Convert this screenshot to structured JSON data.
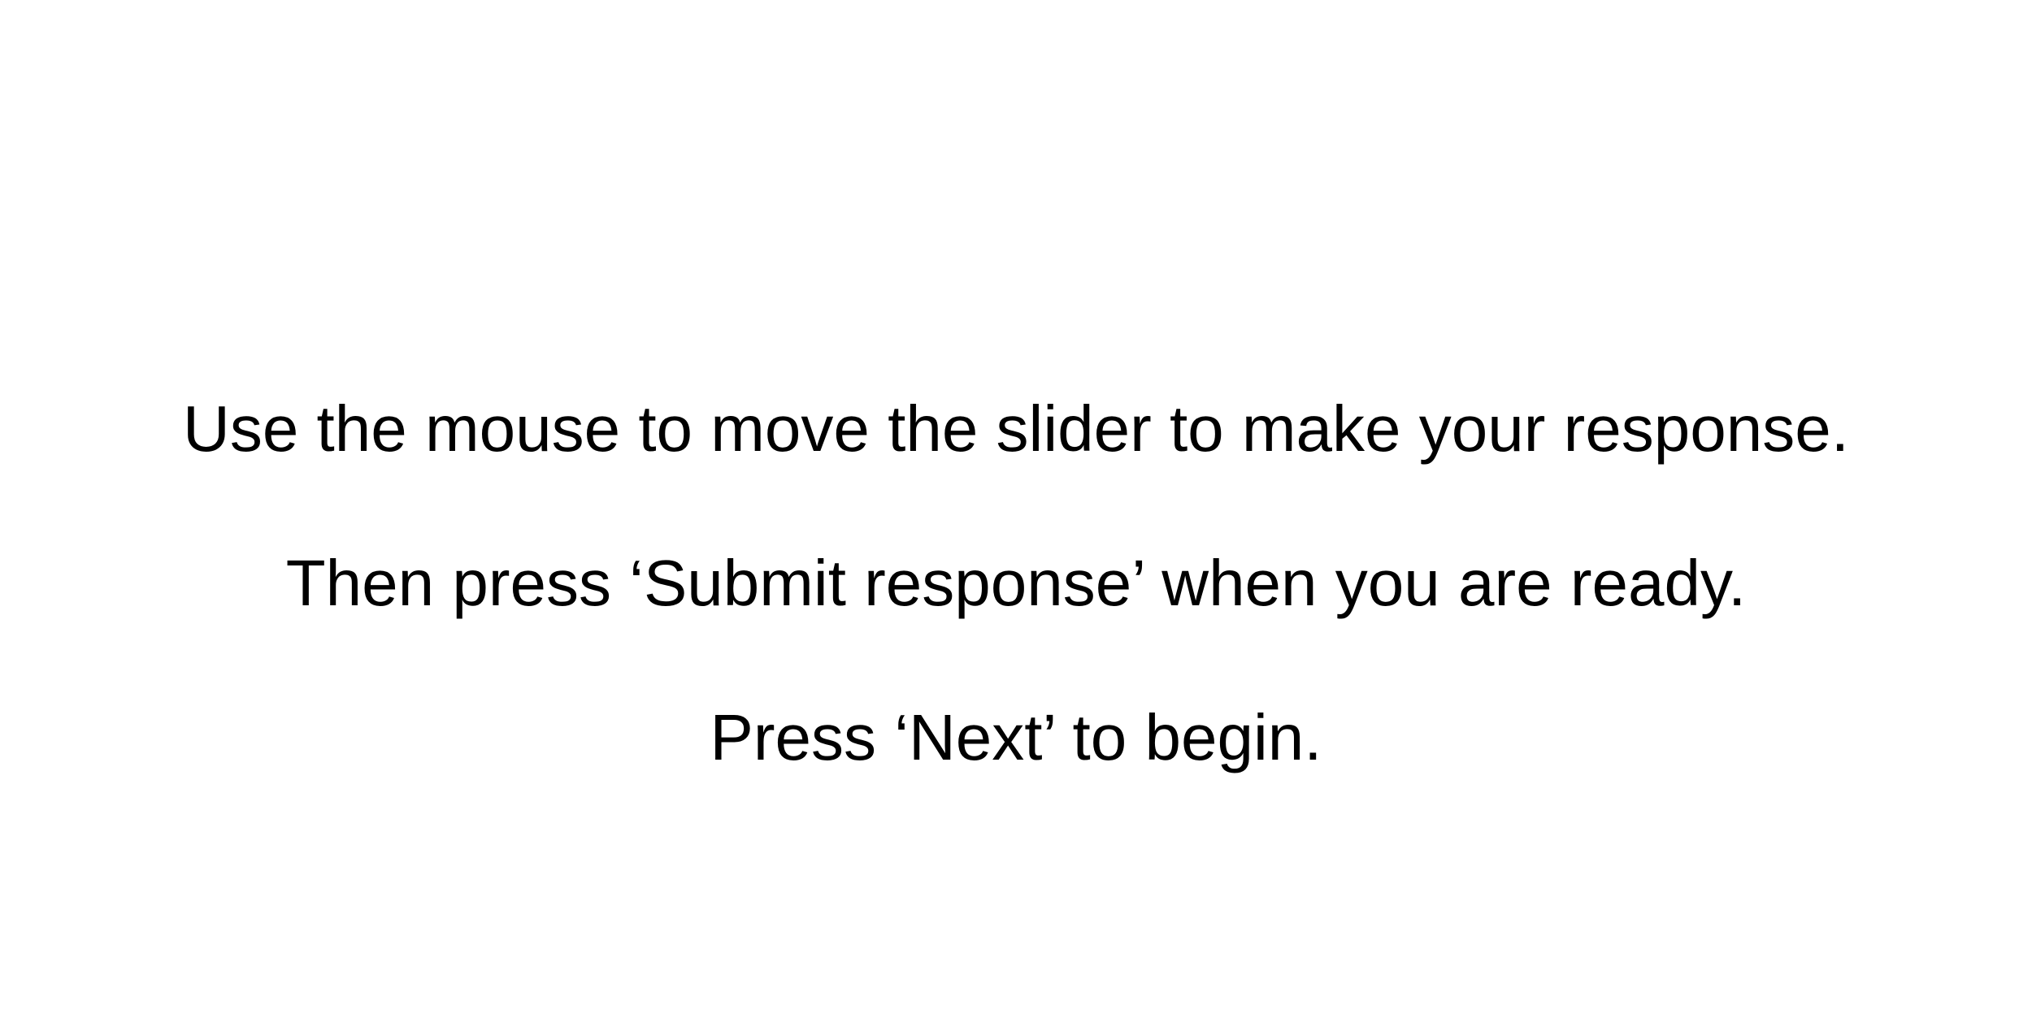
{
  "instructions": {
    "lines": [
      "Use the mouse to move the slider to make your response.",
      "Then press ‘Submit response’ when you are ready.",
      "Press ‘Next’ to begin."
    ]
  },
  "colors": {
    "background": "#ffffff",
    "text": "#000000"
  }
}
